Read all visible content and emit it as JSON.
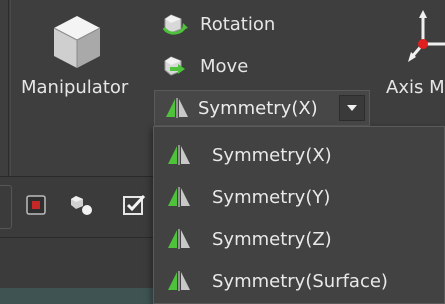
{
  "ribbon": {
    "manipulator": {
      "label": "Manipulator",
      "icon": "cube-icon"
    },
    "rotation": {
      "label": "Rotation",
      "icon": "rotation-icon"
    },
    "move": {
      "label": "Move",
      "icon": "move-icon"
    },
    "symmetry": {
      "selected": "Symmetry(X)",
      "icon": "symmetry-icon"
    },
    "axis": {
      "label": "Axis M",
      "icon": "axis-icon"
    }
  },
  "symmetry_options": [
    "Symmetry(X)",
    "Symmetry(Y)",
    "Symmetry(Z)",
    "Symmetry(Surface)"
  ],
  "toolbar": {
    "icons": [
      "record-icon",
      "shape-icon",
      "checkbox-icon"
    ]
  },
  "colors": {
    "background": "#3b3b3b",
    "ribbon": "#3e3e3e",
    "dropdown": "#424242",
    "accent_green": "#4ec23a",
    "axis_red": "#e02020"
  }
}
